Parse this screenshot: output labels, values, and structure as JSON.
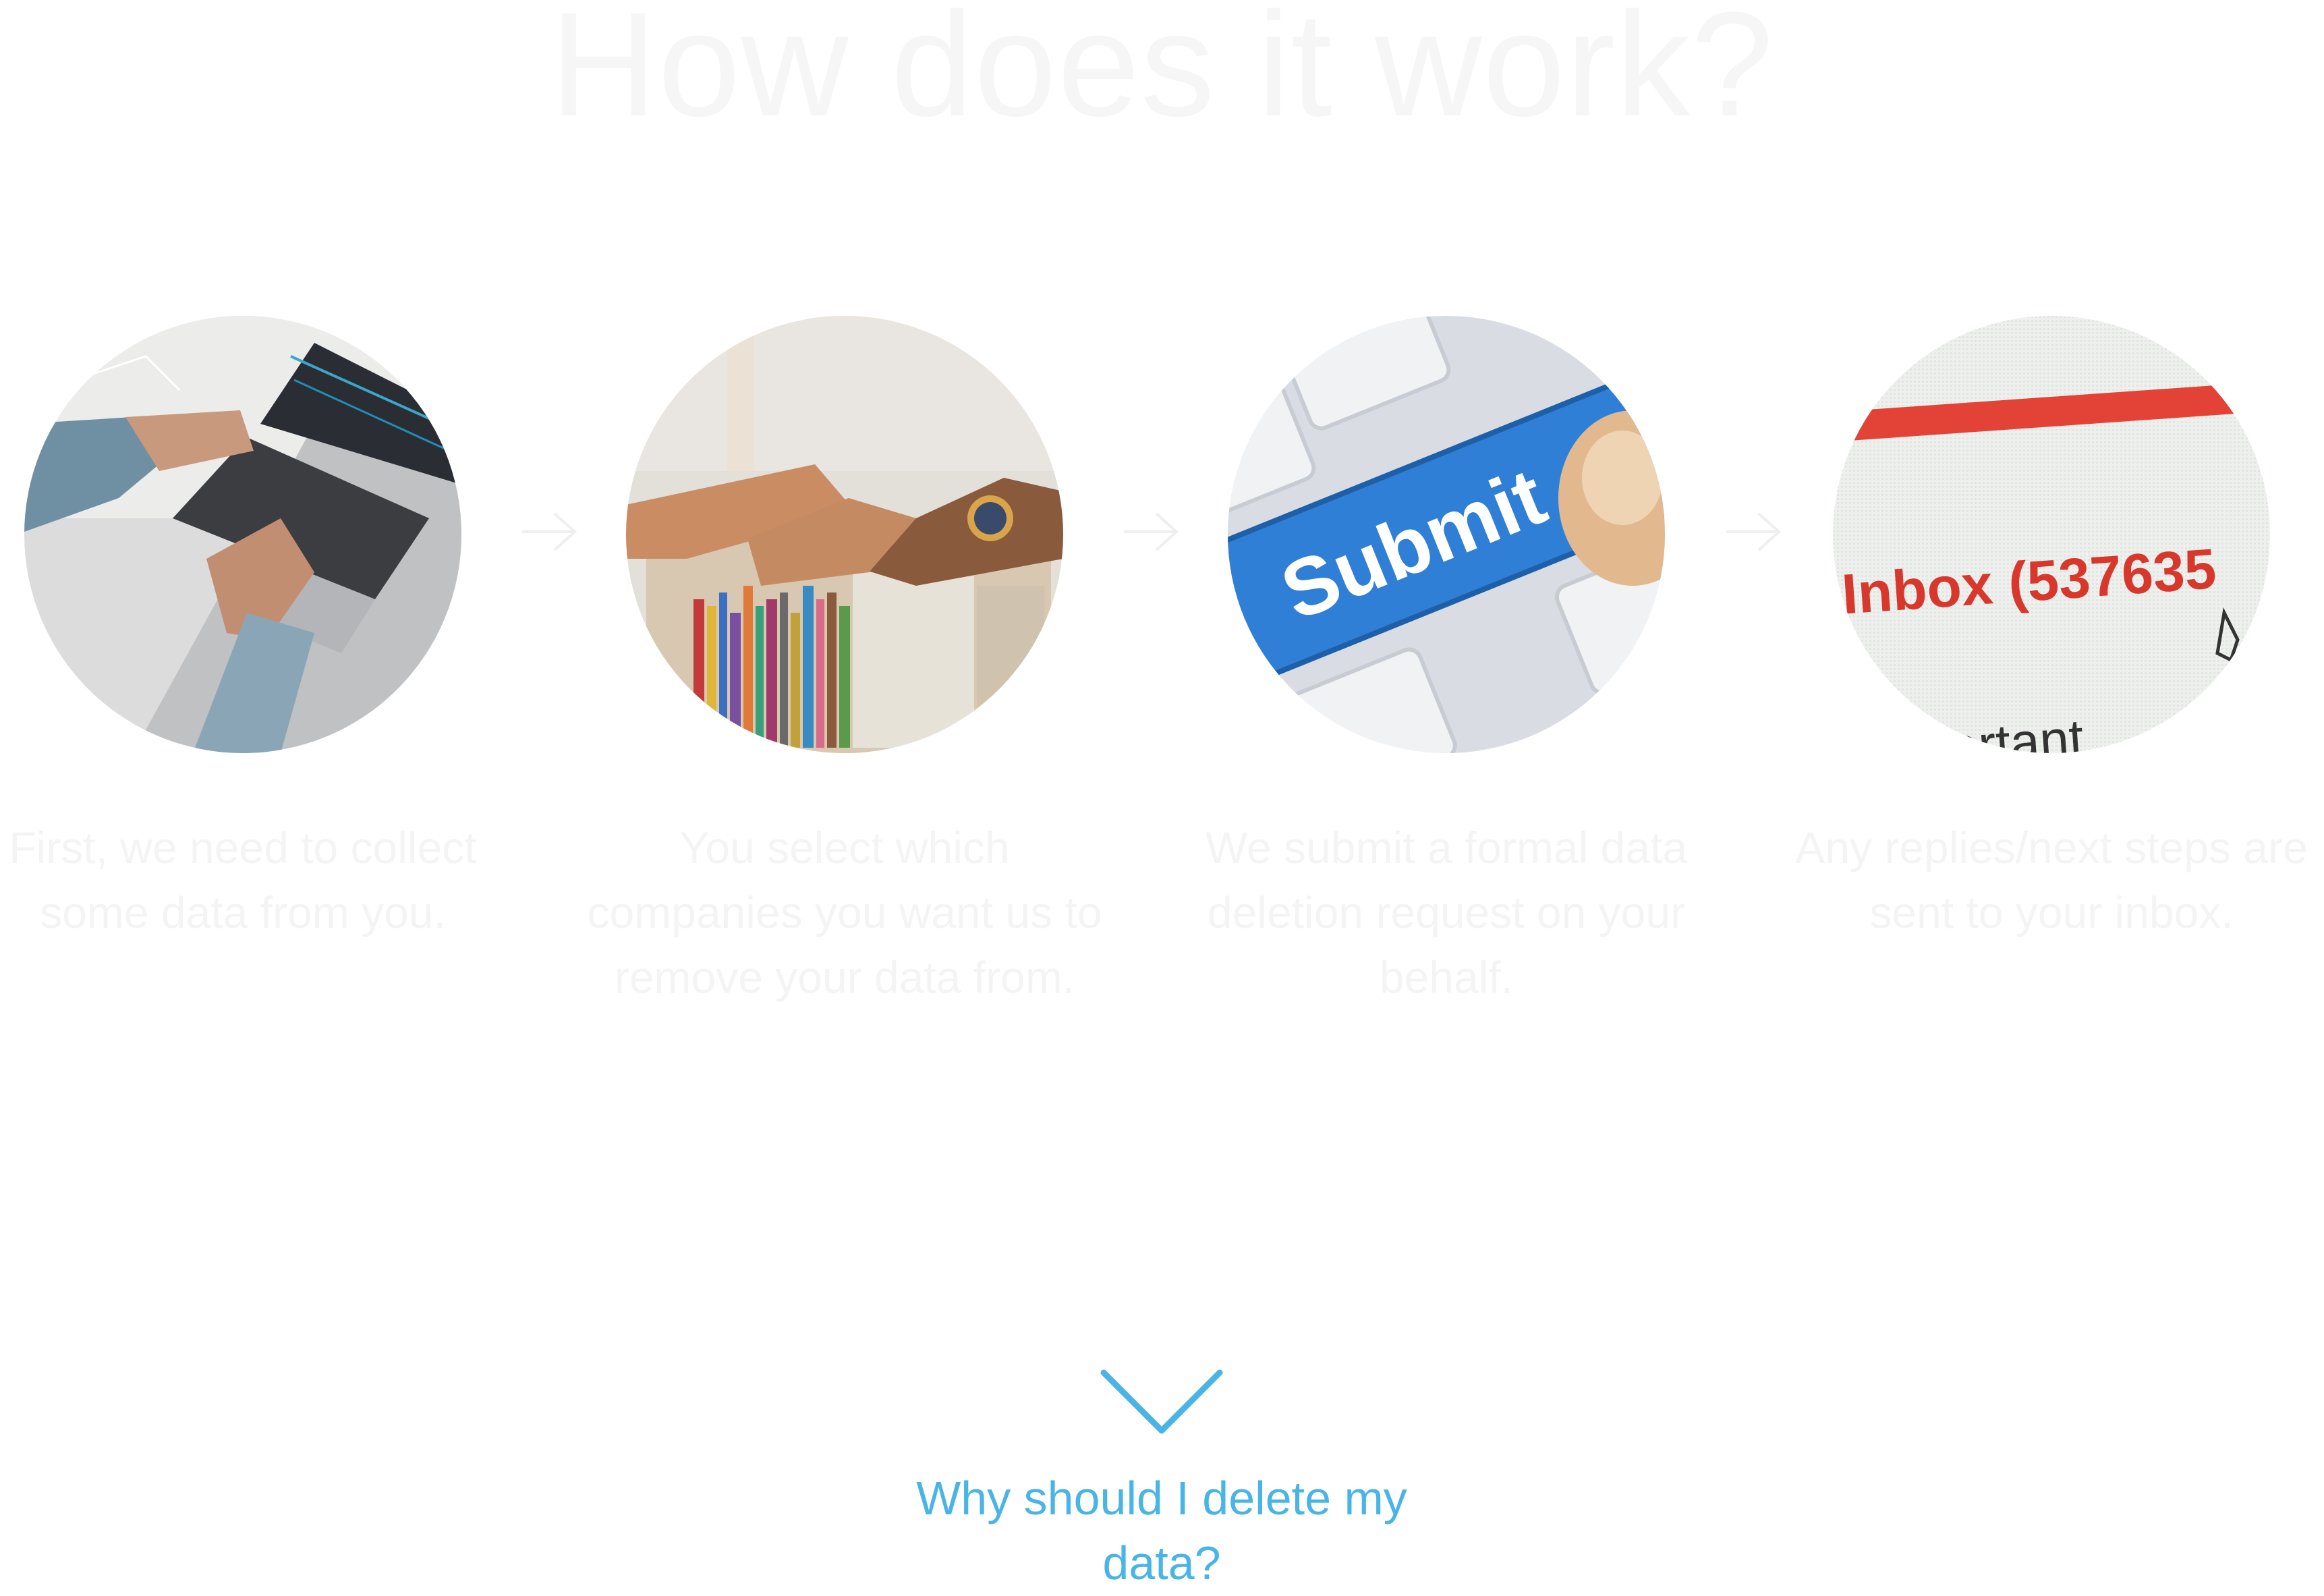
{
  "section": {
    "title": "How does it work?"
  },
  "steps": [
    {
      "image": "laptop-typing-photo",
      "caption": "First, we need to collect some data from you."
    },
    {
      "image": "file-folders-photo",
      "caption": "You select which companies you want us to remove your data from."
    },
    {
      "image": "submit-key-photo",
      "caption": "We submit a formal data deletion request on your behalf.",
      "key_label": "Submit"
    },
    {
      "image": "email-inbox-photo",
      "caption": "Any replies/next steps are sent to your inbox.",
      "inbox_label": "Inbox (537635",
      "partial_label": "ortant"
    }
  ],
  "cta": {
    "label": "Why should I delete my data?",
    "icon": "chevron-down-icon",
    "color": "#49b4e6"
  },
  "colors": {
    "faded_text": "#f4f4f4",
    "submit_blue": "#2f7fd6",
    "inbox_red": "#d8372c"
  }
}
